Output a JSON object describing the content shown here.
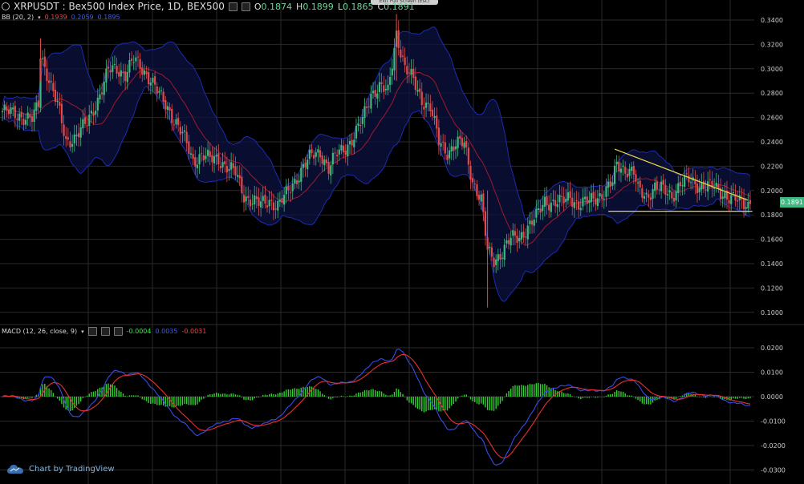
{
  "header": {
    "symbol": "XRPUSDT : Bex500 Index Price, 1D, BEX500",
    "open_key": "O",
    "open": "0.1874",
    "high_key": "H",
    "high": "0.1899",
    "low_key": "L",
    "low": "0.1865",
    "close_key": "C",
    "close": "0.1891",
    "fullscreen_tooltip": "Exit Full Screen (Esc)"
  },
  "indicators": {
    "bb": {
      "label": "BB (20, 2)",
      "upper": "0.1939",
      "middle": "0.2059",
      "lower": "0.1895"
    },
    "macd": {
      "label": "MACD (12, 26, close, 9)",
      "hist": "-0.0004",
      "macd": "0.0035",
      "signal": "-0.0031"
    }
  },
  "price_tag": "0.1891",
  "brand": "Chart by TradingView",
  "colors": {
    "up": "#3fb87f",
    "down": "#e24a4a",
    "bb_band": "#1c2cb0",
    "bb_mid": "#a01a2a",
    "macd": "#3a4ae8",
    "signal": "#e83030",
    "hist": "#2fd02f",
    "triangle": "#e8d84a",
    "grid": "#2a2a2a"
  },
  "chart_data": {
    "type": "candlestick",
    "price_axis": {
      "ticks": [
        0.34,
        0.32,
        0.3,
        0.28,
        0.26,
        0.24,
        0.22,
        0.2,
        0.18,
        0.16,
        0.14,
        0.12,
        0.1
      ],
      "labels": [
        "0.3400",
        "0.3200",
        "0.3000",
        "0.2800",
        "0.2600",
        "0.2400",
        "0.2200",
        "0.2000",
        "0.1800",
        "0.1600",
        "0.1400",
        "0.1200",
        "0.1000"
      ]
    },
    "macd_axis": {
      "ticks": [
        0.02,
        0.01,
        0.0,
        -0.01,
        -0.02,
        -0.03
      ],
      "labels": [
        "0.0200",
        "0.0100",
        "0.0000",
        "-0.0100",
        "-0.0200",
        "-0.0300"
      ]
    },
    "close_keyframes": [
      [
        0,
        0.265
      ],
      [
        8,
        0.262
      ],
      [
        14,
        0.258
      ],
      [
        17,
        0.27
      ],
      [
        18,
        0.312
      ],
      [
        22,
        0.292
      ],
      [
        26,
        0.27
      ],
      [
        30,
        0.24
      ],
      [
        34,
        0.244
      ],
      [
        40,
        0.255
      ],
      [
        45,
        0.275
      ],
      [
        50,
        0.298
      ],
      [
        54,
        0.3
      ],
      [
        58,
        0.296
      ],
      [
        62,
        0.307
      ],
      [
        66,
        0.3
      ],
      [
        70,
        0.292
      ],
      [
        74,
        0.278
      ],
      [
        78,
        0.268
      ],
      [
        82,
        0.256
      ],
      [
        86,
        0.242
      ],
      [
        90,
        0.224
      ],
      [
        94,
        0.23
      ],
      [
        98,
        0.225
      ],
      [
        102,
        0.226
      ],
      [
        106,
        0.22
      ],
      [
        110,
        0.214
      ],
      [
        114,
        0.196
      ],
      [
        118,
        0.192
      ],
      [
        122,
        0.188
      ],
      [
        126,
        0.192
      ],
      [
        130,
        0.188
      ],
      [
        134,
        0.196
      ],
      [
        138,
        0.208
      ],
      [
        142,
        0.22
      ],
      [
        146,
        0.228
      ],
      [
        150,
        0.232
      ],
      [
        154,
        0.218
      ],
      [
        158,
        0.23
      ],
      [
        162,
        0.236
      ],
      [
        166,
        0.244
      ],
      [
        170,
        0.258
      ],
      [
        174,
        0.28
      ],
      [
        178,
        0.285
      ],
      [
        182,
        0.28
      ],
      [
        186,
        0.33
      ],
      [
        190,
        0.3
      ],
      [
        194,
        0.29
      ],
      [
        198,
        0.275
      ],
      [
        202,
        0.268
      ],
      [
        206,
        0.24
      ],
      [
        210,
        0.232
      ],
      [
        214,
        0.238
      ],
      [
        218,
        0.238
      ],
      [
        222,
        0.208
      ],
      [
        226,
        0.192
      ],
      [
        229,
        0.15
      ],
      [
        232,
        0.143
      ],
      [
        236,
        0.15
      ],
      [
        240,
        0.16
      ],
      [
        244,
        0.162
      ],
      [
        248,
        0.17
      ],
      [
        252,
        0.178
      ],
      [
        256,
        0.192
      ],
      [
        260,
        0.19
      ],
      [
        264,
        0.19
      ],
      [
        268,
        0.196
      ],
      [
        272,
        0.188
      ],
      [
        276,
        0.19
      ],
      [
        280,
        0.195
      ],
      [
        284,
        0.198
      ],
      [
        288,
        0.206
      ],
      [
        290,
        0.222
      ],
      [
        294,
        0.218
      ],
      [
        298,
        0.214
      ],
      [
        300,
        0.2
      ],
      [
        304,
        0.196
      ],
      [
        308,
        0.203
      ],
      [
        312,
        0.2
      ],
      [
        316,
        0.196
      ],
      [
        320,
        0.206
      ],
      [
        324,
        0.208
      ],
      [
        328,
        0.205
      ],
      [
        332,
        0.204
      ],
      [
        336,
        0.202
      ],
      [
        340,
        0.198
      ],
      [
        344,
        0.194
      ],
      [
        348,
        0.19
      ],
      [
        352,
        0.189
      ]
    ],
    "triangle": {
      "upper": [
        [
          0.234,
          289
        ],
        [
          0.192,
          352
        ]
      ],
      "lower": [
        [
          0.183,
          286
        ],
        [
          0.183,
          354
        ]
      ]
    },
    "bars": 354
  }
}
